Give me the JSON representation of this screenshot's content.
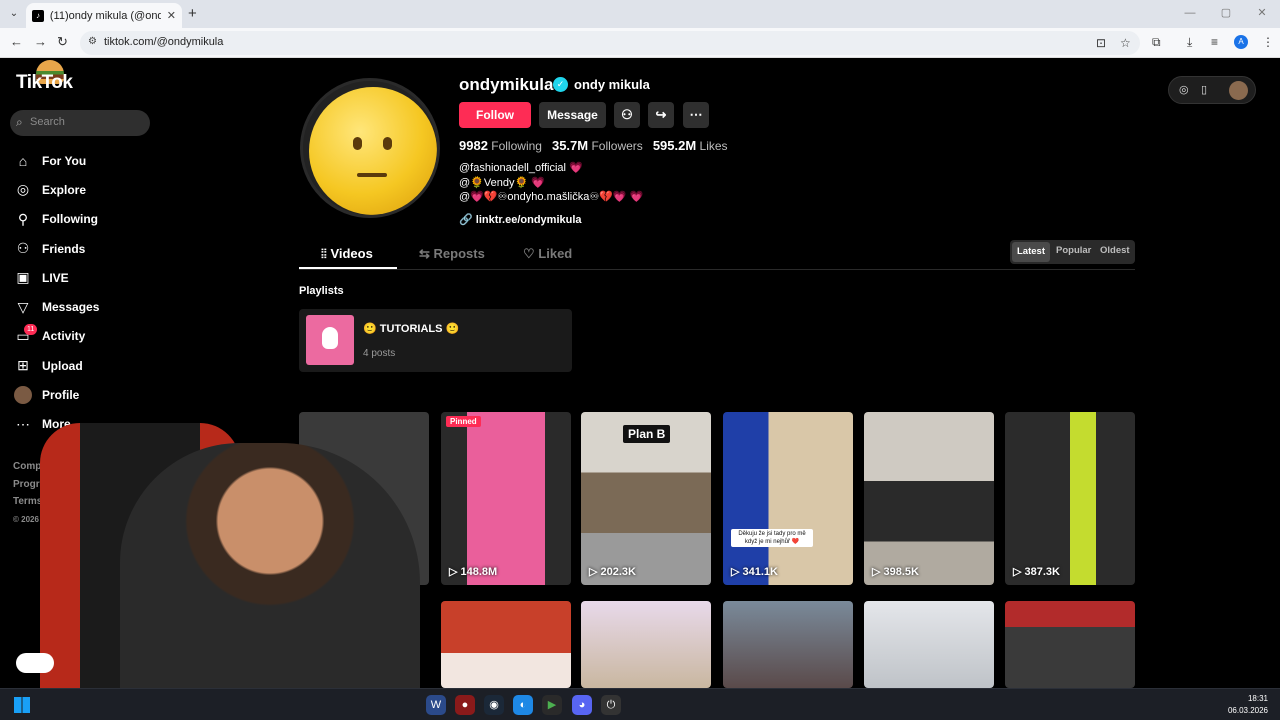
{
  "browser": {
    "tab_title": "(11)ondy mikula (@ondymikula",
    "url": "tiktok.com/@ondymikula",
    "profile_initial": "A"
  },
  "sidebar": {
    "logo": "TikTok",
    "search_placeholder": "Search",
    "items": [
      {
        "label": "For You",
        "icon": "home-icon"
      },
      {
        "label": "Explore",
        "icon": "compass-icon"
      },
      {
        "label": "Following",
        "icon": "following-icon"
      },
      {
        "label": "Friends",
        "icon": "friends-icon"
      },
      {
        "label": "LIVE",
        "icon": "live-icon"
      },
      {
        "label": "Messages",
        "icon": "messages-icon"
      },
      {
        "label": "Activity",
        "icon": "activity-icon",
        "badge": "11"
      },
      {
        "label": "Upload",
        "icon": "upload-icon"
      },
      {
        "label": "Profile",
        "icon": "avatar"
      },
      {
        "label": "More",
        "icon": "more-icon"
      }
    ],
    "footer": [
      "Company",
      "Program",
      "Terms & Poli",
      "© 2026 TikT"
    ]
  },
  "profile": {
    "username": "ondymikula",
    "nickname": "ondy mikula",
    "follow_label": "Follow",
    "message_label": "Message",
    "following_count": "9982",
    "following_label": "Following",
    "followers_count": "35.7M",
    "followers_label": "Followers",
    "likes_count": "595.2M",
    "likes_label": "Likes",
    "bio_lines": [
      "@fashionadell_official",
      "@🌻Vendy🌻",
      "@💗💔♾ondyho.mašlička♾💔💗"
    ],
    "link": "linktr.ee/ondymikula"
  },
  "tabs": {
    "videos": "Videos",
    "reposts": "Reposts",
    "liked": "Liked"
  },
  "sort": {
    "latest": "Latest",
    "popular": "Popular",
    "oldest": "Oldest",
    "selected": "Latest"
  },
  "playlists": {
    "heading": "Playlists",
    "items": [
      {
        "title": "🙂 TUTORIALS 🙂",
        "count": "4 posts"
      }
    ]
  },
  "videos": [
    {
      "views": "148.8M",
      "pinned_label": "Pinned"
    },
    {
      "views": "202.3K",
      "overlay": "Plan B"
    },
    {
      "views": "341.1K",
      "caption": "Děkuju že jsi tady pro mě když je mi nejhůř ❤️"
    },
    {
      "views": "398.5K"
    },
    {
      "views": "387.3K"
    }
  ],
  "taskbar": {
    "time": "18:31",
    "date": "06.03.2026"
  },
  "colors": {
    "accent": "#fe2c55",
    "verified": "#20d5ec"
  }
}
